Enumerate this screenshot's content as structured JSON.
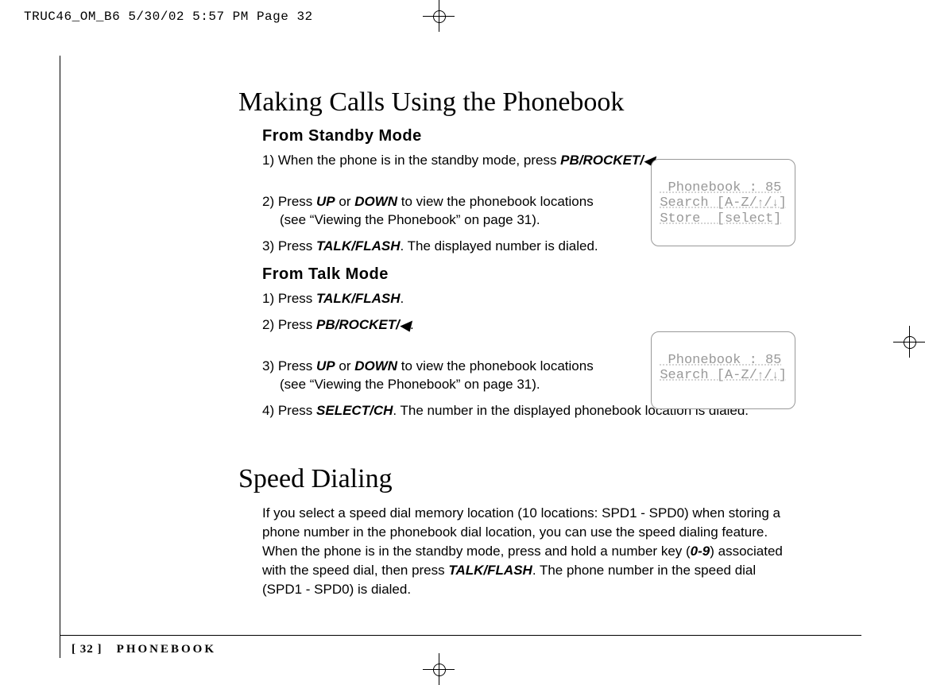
{
  "header_line": "TRUC46_OM_B6  5/30/02  5:57 PM  Page 32",
  "title1": "Making Calls Using the Phonebook",
  "standby": {
    "heading": "From Standby Mode",
    "s1_a": "1) When the phone is in the standby mode, press ",
    "s1_key": "PB/ROCKET/",
    "s1_b": ".",
    "s2_a": "2) Press ",
    "s2_k1": "UP",
    "s2_mid": " or ",
    "s2_k2": "DOWN",
    "s2_b": " to view the phonebook locations",
    "s2_c": "(see “Viewing the Phonebook” on page 31).",
    "s3_a": "3) Press ",
    "s3_k": "TALK/FLASH",
    "s3_b": ". The displayed number is dialed."
  },
  "talk": {
    "heading": "From Talk Mode",
    "s1_a": "1) Press ",
    "s1_k": "TALK/FLASH",
    "s1_b": ".",
    "s2_a": "2) Press ",
    "s2_k": "PB/ROCKET/",
    "s2_b": ".",
    "s3_a": "3) Press ",
    "s3_k1": "UP",
    "s3_mid": " or ",
    "s3_k2": "DOWN",
    "s3_b": " to view the phonebook locations",
    "s3_c": "(see “Viewing the Phonebook” on page 31).",
    "s4_a": "4) Press ",
    "s4_k": "SELECT/CH",
    "s4_b": ". The number in the displayed phonebook location is dialed."
  },
  "title2": "Speed Dialing",
  "speed": {
    "p_a": "If you select a speed dial memory location (10 locations: SPD1 - SPD0) when storing a phone number in the phonebook dial location, you can use the speed dialing feature. When the phone is in the standby mode, press and hold a number key (",
    "p_k1": "0-9",
    "p_mid": ") associated with the speed dial, then press ",
    "p_k2": "TALK/FLASH",
    "p_b": ". The phone number in the speed dial (SPD1 - SPD0) is dialed."
  },
  "lcd1": {
    "l1": " Phonebook : 85",
    "l2a": "Search [A-Z/",
    "l2b": "/",
    "l2c": "]",
    "l3": "Store  [select]"
  },
  "lcd2": {
    "l1": " Phonebook : 85",
    "l2a": "Search [A-Z/",
    "l2b": "/",
    "l2c": "]"
  },
  "footer": {
    "page": "[ 32 ]",
    "section": "PHONEBOOK"
  }
}
